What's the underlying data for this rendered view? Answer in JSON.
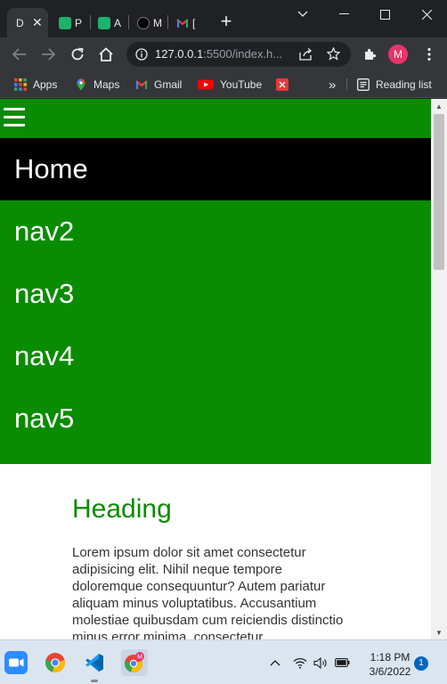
{
  "browser": {
    "tabs": [
      {
        "label": "D",
        "icon": "document-icon",
        "active": true
      },
      {
        "label": "P",
        "icon": "cube-icon"
      },
      {
        "label": "A",
        "icon": "cube-icon"
      },
      {
        "label": "M",
        "icon": "github-icon"
      },
      {
        "label": "[",
        "icon": "gmail-icon"
      }
    ],
    "address": {
      "host": "127.0.0.1",
      "rest": ":5500/index.h..."
    },
    "profile_initial": "M",
    "bookmarks": [
      {
        "label": "Apps",
        "icon": "apps-grid-icon"
      },
      {
        "label": "Maps",
        "icon": "maps-pin-icon"
      },
      {
        "label": "Gmail",
        "icon": "gmail-icon"
      },
      {
        "label": "YouTube",
        "icon": "youtube-icon"
      },
      {
        "label": "",
        "icon": "red-x-icon"
      }
    ],
    "overflow_label": "»",
    "reading_list_label": "Reading list"
  },
  "page": {
    "nav": [
      "Home",
      "nav2",
      "nav3",
      "nav4",
      "nav5"
    ],
    "active_nav": "Home",
    "heading": "Heading",
    "paragraph": "Lorem ipsum dolor sit amet consectetur adipisicing elit. Nihil neque tempore doloremque consequuntur? Autem pariatur aliquam minus voluptatibus. Accusantium molestiae quibusdam cum reiciendis distinctio minus error minima, consectetur",
    "colors": {
      "brand_green": "#0a8c00",
      "active_nav": "#000000"
    }
  },
  "taskbar": {
    "apps": [
      "zoom-icon",
      "chrome-icon",
      "vscode-icon",
      "chrome-profile-icon"
    ],
    "time": "1:18 PM",
    "date": "3/6/2022",
    "notification_count": "1"
  }
}
